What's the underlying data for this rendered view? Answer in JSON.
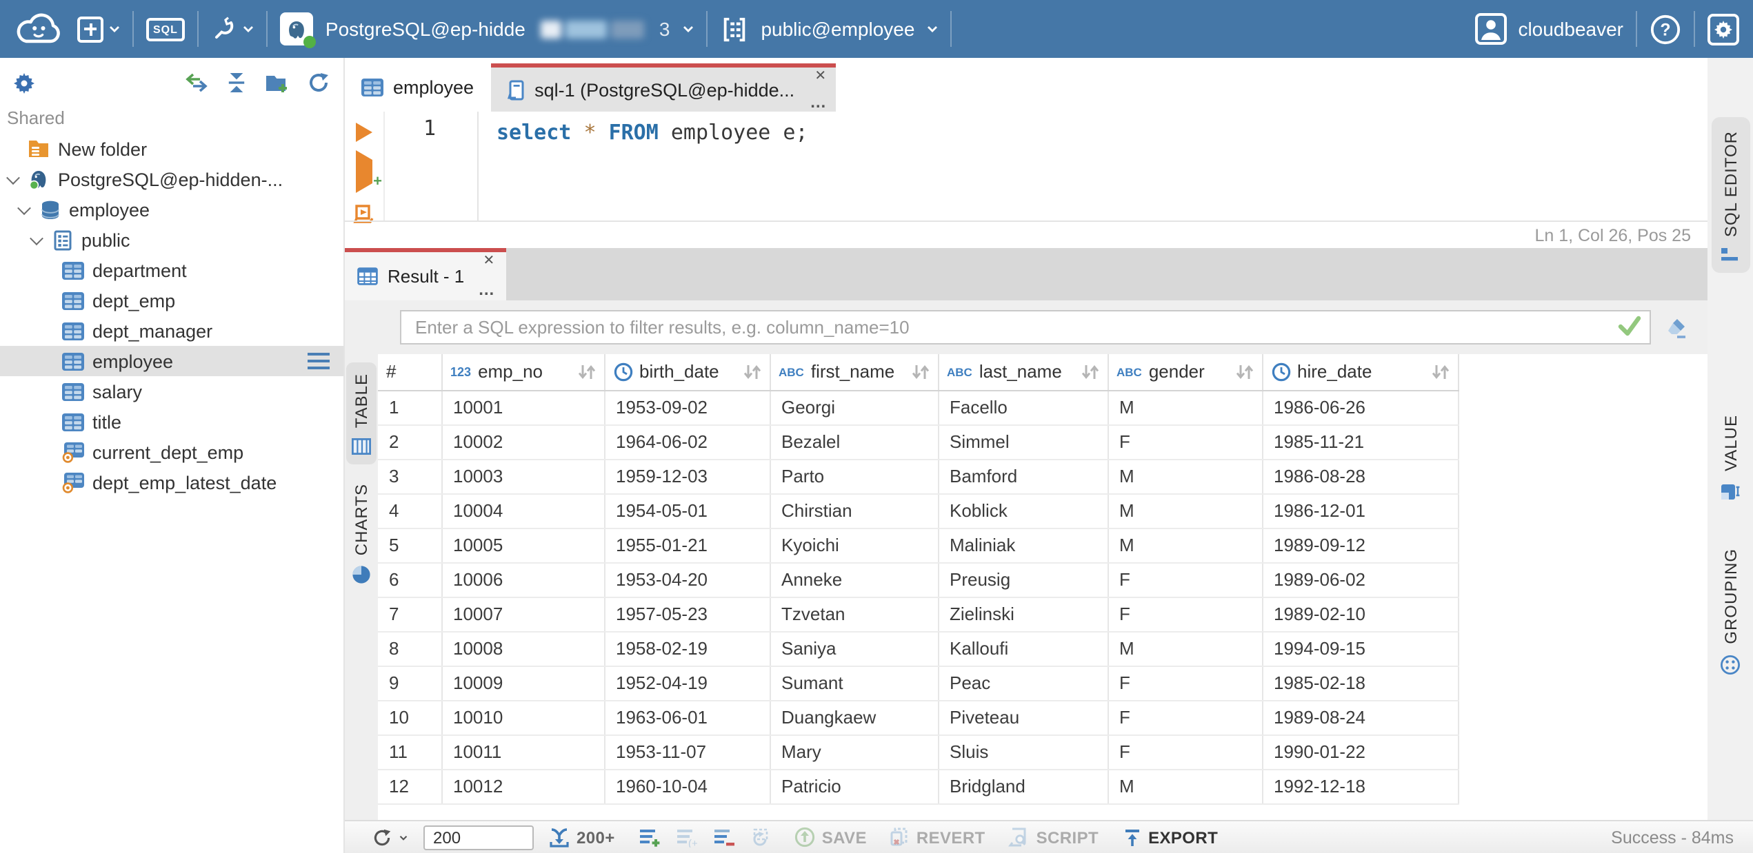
{
  "header": {
    "connection_label": "PostgreSQL@ep-hidde",
    "connection_suffix": "3",
    "schema_label": "public@employee",
    "username": "cloudbeaver",
    "sql_badge": "SQL"
  },
  "sidebar": {
    "section": "Shared",
    "tree": [
      {
        "label": "New folder",
        "icon": "folder-db",
        "level": 0,
        "chevron": false,
        "selected": false
      },
      {
        "label": "PostgreSQL@ep-hidden-...",
        "icon": "postgres",
        "level": 0,
        "chevron": true,
        "selected": false
      },
      {
        "label": "employee",
        "icon": "database",
        "level": 1,
        "chevron": true,
        "selected": false
      },
      {
        "label": "public",
        "icon": "schema",
        "level": 2,
        "chevron": true,
        "selected": false
      },
      {
        "label": "department",
        "icon": "table",
        "level": 3,
        "chevron": false,
        "selected": false
      },
      {
        "label": "dept_emp",
        "icon": "table",
        "level": 3,
        "chevron": false,
        "selected": false
      },
      {
        "label": "dept_manager",
        "icon": "table",
        "level": 3,
        "chevron": false,
        "selected": false
      },
      {
        "label": "employee",
        "icon": "table",
        "level": 3,
        "chevron": false,
        "selected": true,
        "menu": true
      },
      {
        "label": "salary",
        "icon": "table",
        "level": 3,
        "chevron": false,
        "selected": false
      },
      {
        "label": "title",
        "icon": "table",
        "level": 3,
        "chevron": false,
        "selected": false
      },
      {
        "label": "current_dept_emp",
        "icon": "view",
        "level": 3,
        "chevron": false,
        "selected": false
      },
      {
        "label": "dept_emp_latest_date",
        "icon": "view",
        "level": 3,
        "chevron": false,
        "selected": false
      }
    ]
  },
  "editor": {
    "tabs": [
      {
        "label": "employee",
        "icon": "table",
        "active": false
      },
      {
        "label": "sql-1 (PostgreSQL@ep-hidde...",
        "icon": "sql-script",
        "active": true
      }
    ],
    "line_number": "1",
    "code_tokens": [
      {
        "text": "select",
        "style": "kw"
      },
      {
        "text": " ",
        "style": "plain"
      },
      {
        "text": "*",
        "style": "op"
      },
      {
        "text": " ",
        "style": "plain"
      },
      {
        "text": "FROM",
        "style": "kw"
      },
      {
        "text": " employee e;",
        "style": "plain"
      }
    ],
    "status": "Ln 1, Col 26, Pos 25"
  },
  "result": {
    "tab_label": "Result - 1",
    "filter_placeholder": "Enter a SQL expression to filter results, e.g. column_name=10",
    "view_tabs": [
      {
        "label": "TABLE",
        "active": true
      },
      {
        "label": "CHARTS",
        "active": false
      }
    ]
  },
  "grid": {
    "columns": [
      {
        "name": "#",
        "type": "rownum"
      },
      {
        "name": "emp_no",
        "type": "number"
      },
      {
        "name": "birth_date",
        "type": "date"
      },
      {
        "name": "first_name",
        "type": "text"
      },
      {
        "name": "last_name",
        "type": "text"
      },
      {
        "name": "gender",
        "type": "text"
      },
      {
        "name": "hire_date",
        "type": "date"
      }
    ],
    "rows": [
      [
        "1",
        "10001",
        "1953-09-02",
        "Georgi",
        "Facello",
        "M",
        "1986-06-26"
      ],
      [
        "2",
        "10002",
        "1964-06-02",
        "Bezalel",
        "Simmel",
        "F",
        "1985-11-21"
      ],
      [
        "3",
        "10003",
        "1959-12-03",
        "Parto",
        "Bamford",
        "M",
        "1986-08-28"
      ],
      [
        "4",
        "10004",
        "1954-05-01",
        "Chirstian",
        "Koblick",
        "M",
        "1986-12-01"
      ],
      [
        "5",
        "10005",
        "1955-01-21",
        "Kyoichi",
        "Maliniak",
        "M",
        "1989-09-12"
      ],
      [
        "6",
        "10006",
        "1953-04-20",
        "Anneke",
        "Preusig",
        "F",
        "1989-06-02"
      ],
      [
        "7",
        "10007",
        "1957-05-23",
        "Tzvetan",
        "Zielinski",
        "F",
        "1989-02-10"
      ],
      [
        "8",
        "10008",
        "1958-02-19",
        "Saniya",
        "Kalloufi",
        "M",
        "1994-09-15"
      ],
      [
        "9",
        "10009",
        "1952-04-19",
        "Sumant",
        "Peac",
        "F",
        "1985-02-18"
      ],
      [
        "10",
        "10010",
        "1963-06-01",
        "Duangkaew",
        "Piveteau",
        "F",
        "1989-08-24"
      ],
      [
        "11",
        "10011",
        "1953-11-07",
        "Mary",
        "Sluis",
        "F",
        "1990-01-22"
      ],
      [
        "12",
        "10012",
        "1960-10-04",
        "Patricio",
        "Bridgland",
        "M",
        "1992-12-18"
      ]
    ]
  },
  "statusbar": {
    "row_limit": "200",
    "fetch_more": "200+",
    "save": "SAVE",
    "revert": "REVERT",
    "script": "SCRIPT",
    "export": "EXPORT",
    "status": "Success - 84ms"
  },
  "right_rail": {
    "tabs": [
      {
        "label": "SQL EDITOR",
        "active": true
      },
      {
        "label": "VALUE",
        "active": false
      },
      {
        "label": "GROUPING",
        "active": false
      }
    ]
  },
  "colors": {
    "header_blue": "#4577a7",
    "accent_red": "#cb4e4e",
    "icon_blue": "#4a86c6",
    "green": "#58a254",
    "orange": "#e8872e",
    "selected_gray": "#e1e1e1"
  }
}
